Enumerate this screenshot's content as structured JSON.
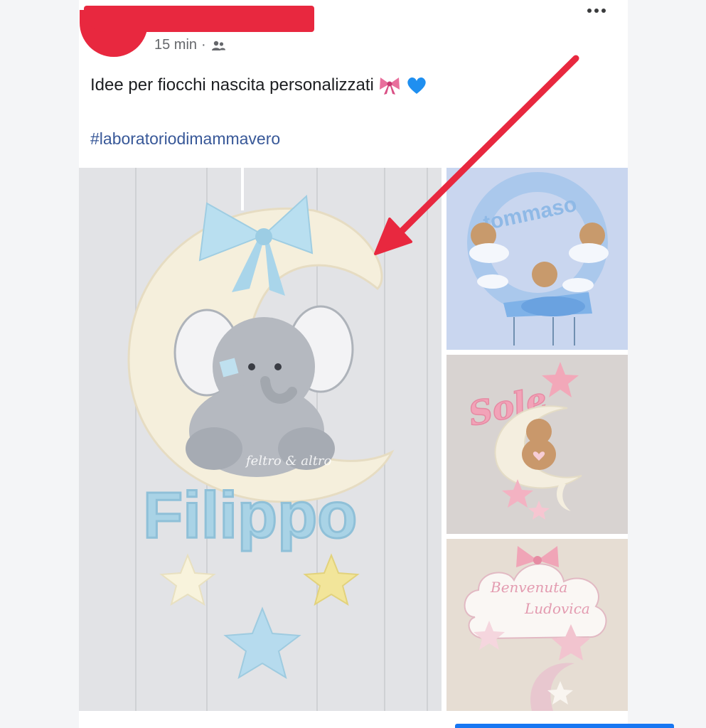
{
  "post": {
    "time": "15 min",
    "separator": "·",
    "audience_icon": "group-icon",
    "text": "Idee per fiocchi nascita personalizzati",
    "emojis": [
      "ribbon-emoji",
      "blue-heart-emoji"
    ],
    "hashtag": "#laboratoriodimammavero",
    "more_icon": "more-options-icon"
  },
  "photos": {
    "main": {
      "name_text": "Filippo",
      "watermark": "feltro & altro"
    },
    "thumb1": {
      "name_text": "tommaso"
    },
    "thumb2": {
      "name_text": "Sole"
    },
    "thumb3": {
      "line1": "Benvenuta",
      "line2": "Ludovica"
    }
  },
  "colors": {
    "redaction": "#e8283f",
    "link": "#385898",
    "arrow": "#e8283f"
  }
}
